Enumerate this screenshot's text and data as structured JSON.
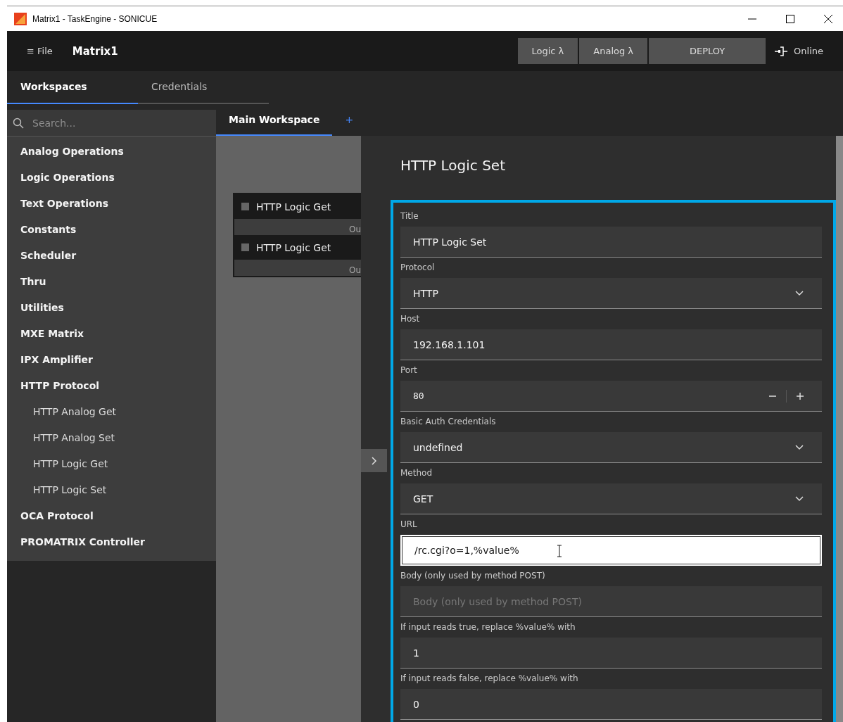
{
  "window": {
    "title": "Matrix1 - TaskEngine - SONICUE"
  },
  "header": {
    "menu": "≡ File",
    "project": "Matrix1",
    "buttons": [
      "Logic λ",
      "Analog λ",
      "DEPLOY"
    ],
    "status": "Online"
  },
  "tabs": [
    {
      "label": "Workspaces",
      "selected": true
    },
    {
      "label": "Credentials",
      "selected": false
    }
  ],
  "search": {
    "placeholder": "Search..."
  },
  "sidebar": {
    "items": [
      {
        "label": "Analog Operations"
      },
      {
        "label": "Logic Operations"
      },
      {
        "label": "Text Operations"
      },
      {
        "label": "Constants"
      },
      {
        "label": "Scheduler"
      },
      {
        "label": "Thru"
      },
      {
        "label": "Utilities"
      },
      {
        "label": "MXE Matrix"
      },
      {
        "label": "IPX Amplifier"
      },
      {
        "label": "HTTP Protocol",
        "children": [
          {
            "label": "HTTP Analog Get"
          },
          {
            "label": "HTTP Analog Set"
          },
          {
            "label": "HTTP Logic Get"
          },
          {
            "label": "HTTP Logic Set"
          }
        ]
      },
      {
        "label": "OCA Protocol"
      },
      {
        "label": "PROMATRIX Controller"
      }
    ]
  },
  "workspace_tabs": [
    {
      "label": "Main Workspace",
      "selected": true
    },
    {
      "label": "+",
      "selected": false
    }
  ],
  "nodes": [
    {
      "title": "HTTP Logic Get",
      "port": "Ou"
    },
    {
      "title": "HTTP Logic Get",
      "port": "Ou"
    }
  ],
  "panel": {
    "title": "HTTP Logic Set",
    "fields": [
      {
        "label": "Title",
        "kind": "text",
        "value": "HTTP Logic Set",
        "focused": false
      },
      {
        "label": "Protocol",
        "kind": "select",
        "value": "HTTP",
        "focused": false
      },
      {
        "label": "Host",
        "kind": "text",
        "value": "192.168.1.101",
        "focused": false
      },
      {
        "label": "Port",
        "kind": "number",
        "value": "80",
        "focused": false
      },
      {
        "label": "Basic Auth Credentials",
        "kind": "select",
        "value": "undefined",
        "focused": false
      },
      {
        "label": "Method",
        "kind": "select",
        "value": "GET",
        "focused": false
      },
      {
        "label": "URL",
        "kind": "text",
        "value": "/rc.cgi?o=1,%value%",
        "focused": true
      },
      {
        "label": "Body (only used by method POST)",
        "kind": "text",
        "placeholder": "Body (only used by method POST)",
        "focused": false
      },
      {
        "label": "If input reads true, replace %value% with",
        "kind": "text",
        "value": "1",
        "focused": false
      },
      {
        "label": "If input reads false, replace %value% with",
        "kind": "text",
        "value": "0",
        "focused": false
      }
    ]
  }
}
